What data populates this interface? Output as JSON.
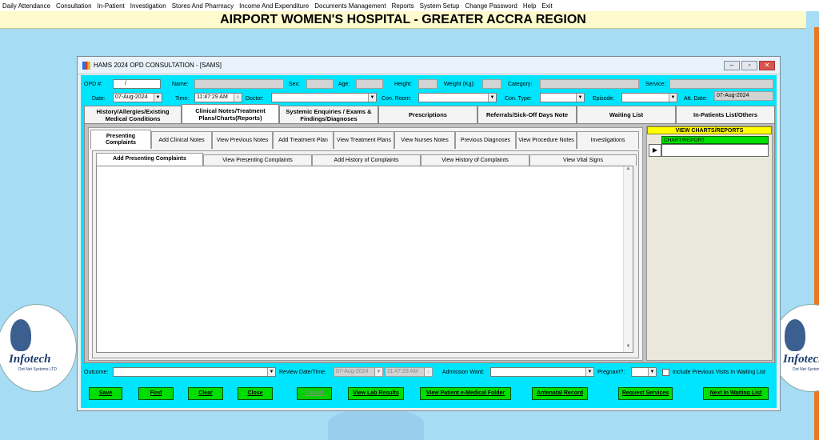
{
  "menu": [
    "Daily Attendance",
    "Consultation",
    "In-Patient",
    "Investigation",
    "Stores And Pharmacy",
    "Income And Expenditure",
    "Documents Management",
    "Reports",
    "System Setup",
    "Change Password",
    "Help",
    "Exit"
  ],
  "banner": "AIRPORT WOMEN'S HOSPITAL - GREATER ACCRA REGION",
  "logo": {
    "brand": "Infotech",
    "sub": "Dot Net Systems LTD"
  },
  "window": {
    "title": "HAMS 2024 OPD CONSULTATION - [SAMS]"
  },
  "form": {
    "opd_label": "OPD #:",
    "opd_value": "/",
    "name_label": "Name:",
    "sex_label": "Sex:",
    "age_label": "Age:",
    "height_label": "Height:",
    "weight_label": "Weight (Kg):",
    "category_label": "Category:",
    "service_label": "Service:",
    "date_label": "Date:",
    "date_value": "07-Aug-2024",
    "time_label": "Time:",
    "time_value": "11:47:29 AM",
    "doctor_label": "Doctor:",
    "conroom_label": "Con. Room:",
    "contype_label": "Con. Type:",
    "episode_label": "Episode:",
    "attdate_label": "Att. Date:",
    "attdate_value": "07-Aug-2024"
  },
  "main_tabs": [
    "History/Allergies/Existing Medical Conditions",
    "Clinical Notes/Treatment Plans/Charts(Reports)",
    "Systemic Enquiries / Exams & Findings/Diagnoses",
    "Prescriptions",
    "Referrals/Sick-Off Days Note",
    "Waiting List",
    "In-Patients List/Others"
  ],
  "sub_tabs": [
    "Presenting Complaints",
    "Add Clinical  Notes",
    "View Previous Notes",
    "Add Treatment Plan",
    "View Treatment Plans",
    "View Nurses Notes",
    "Previous Diagnoses",
    "View Procedure Notes",
    "Investigations"
  ],
  "complaint_tabs": [
    "Add Presenting Complaints",
    "View Presenting Complaints",
    "Add History of Complaints",
    "View History of Complaints",
    "View Vital Signs"
  ],
  "charts": {
    "header": "VIEW CHARTS/REPORTS",
    "column": "CHART/REPORT"
  },
  "bottom": {
    "outcome_label": "Outcome:",
    "review_label": "Review Date/Time:",
    "review_date": "07-Aug-2024",
    "review_time": "11:47:29 AM",
    "ward_label": "Admission Ward:",
    "pregnant_label": "Pregnant?:",
    "include_label": "Include Previous Visits In Waiting List"
  },
  "buttons": [
    "Save",
    "Find",
    "Clear",
    "Close",
    "Cancel",
    "View Lab Results",
    "View Patient e-Medical Folder",
    "Antenatal Record",
    "Request Services",
    "Next In Waiting List"
  ]
}
